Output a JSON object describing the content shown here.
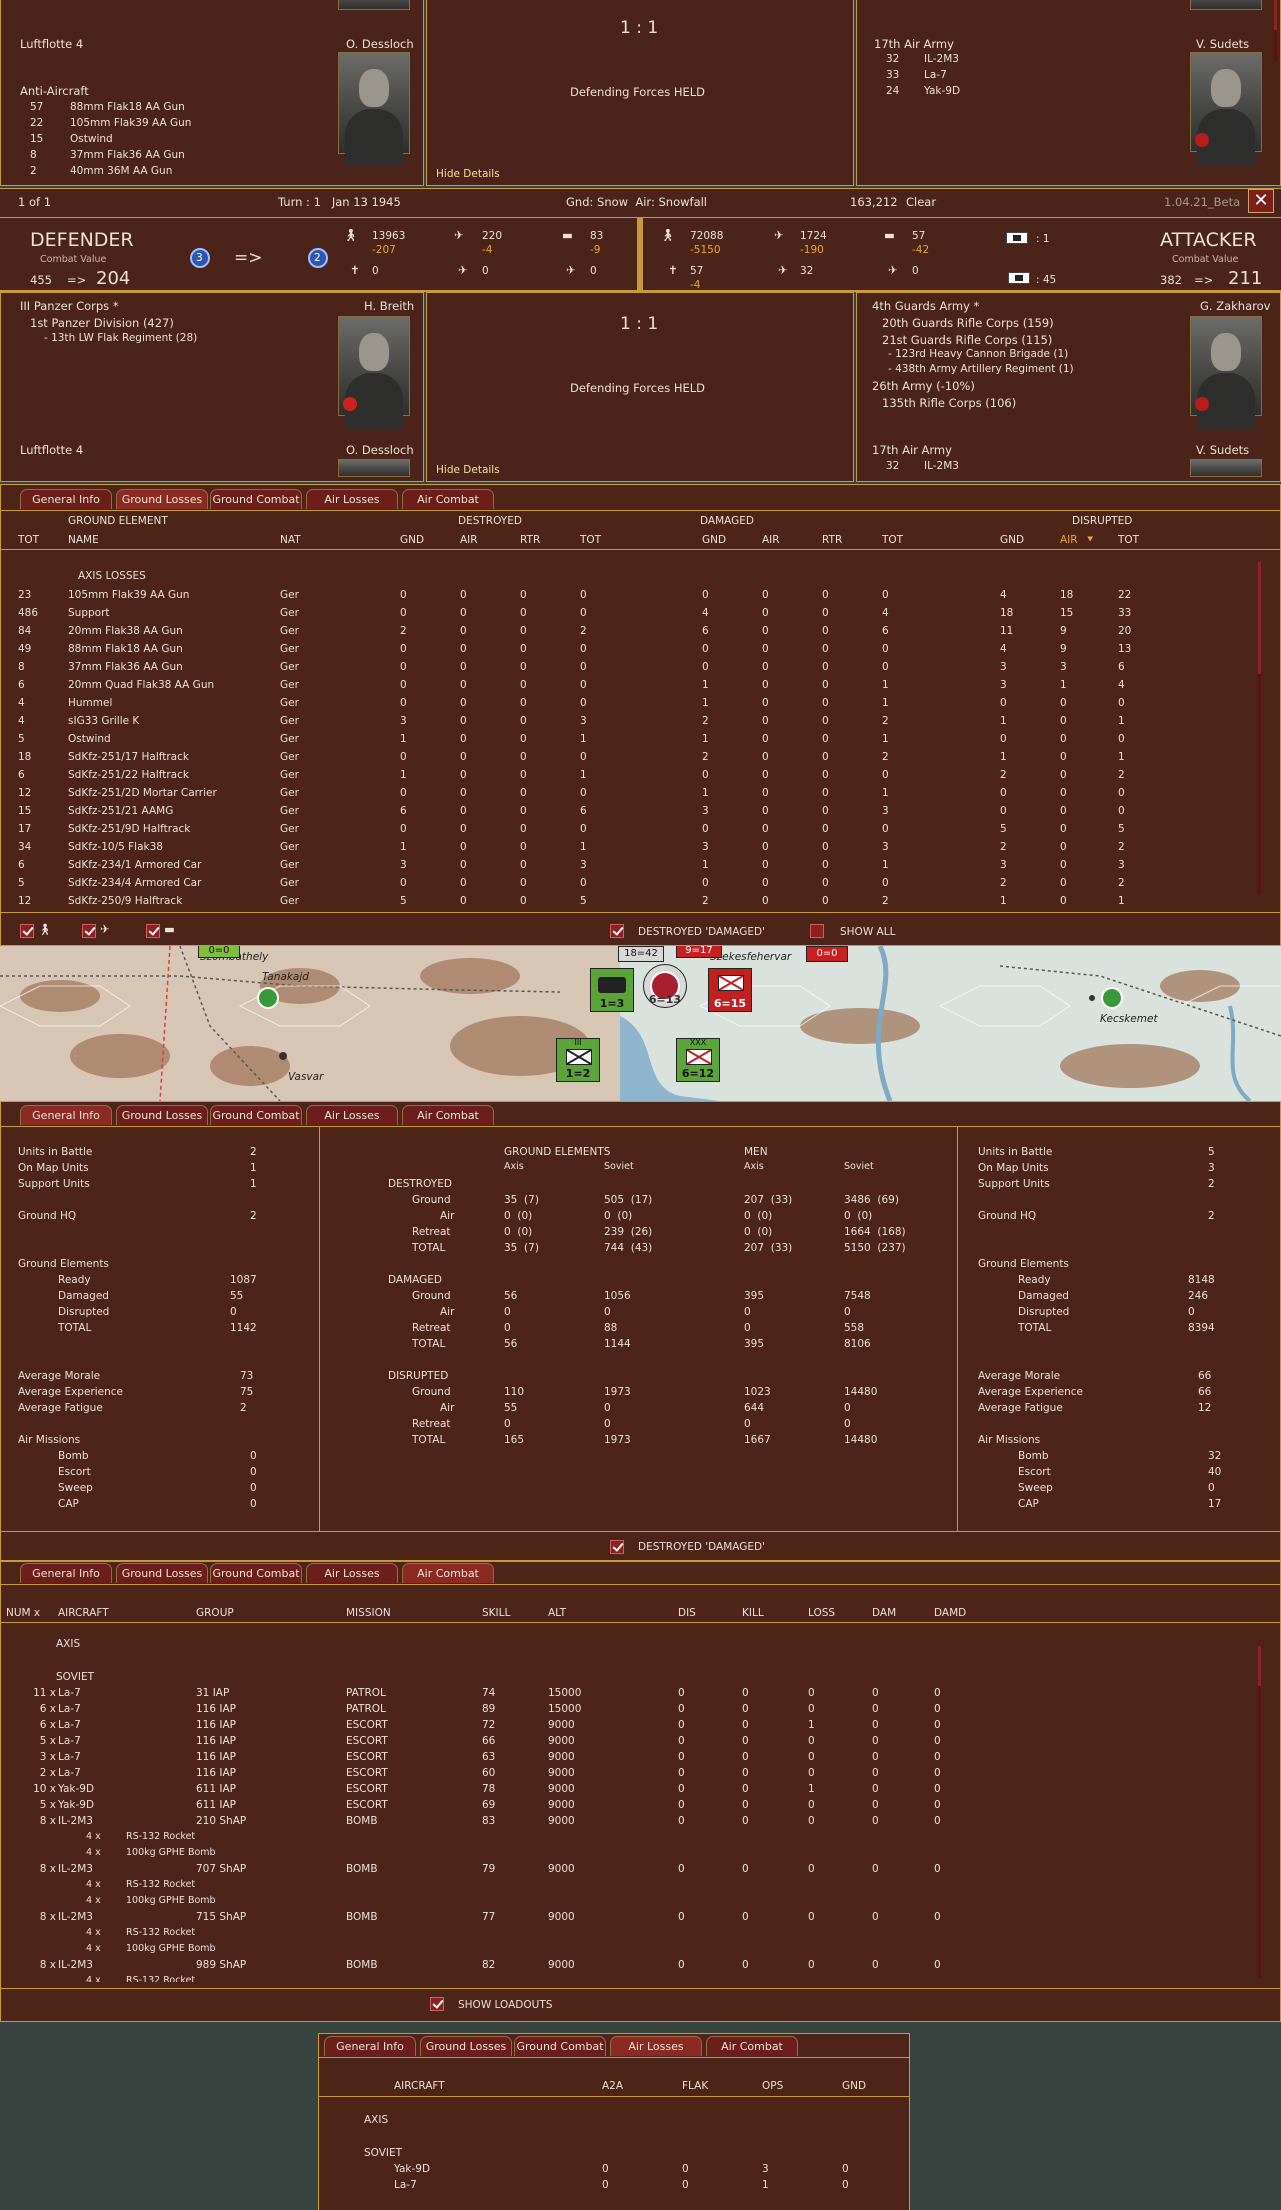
{
  "top_strip": {
    "left_cmd1": "Luftflotte 4",
    "left_leader1": "O. Dessloch",
    "aa_title": "Anti-Aircraft",
    "aa_rows": [
      {
        "n": "57",
        "name": "88mm Flak18 AA Gun"
      },
      {
        "n": "22",
        "name": "105mm Flak39 AA Gun"
      },
      {
        "n": "15",
        "name": "Ostwind"
      },
      {
        "n": "8",
        "name": "37mm Flak36 AA Gun"
      },
      {
        "n": "2",
        "name": "40mm 36M AA Gun"
      }
    ],
    "odds": "1 : 1",
    "result": "Defending Forces HELD",
    "hide_details": "Hide Details",
    "right_cmd": "17th Air Army",
    "right_leader": "V. Sudets",
    "air_rows": [
      {
        "n": "32",
        "name": "IL-2M3"
      },
      {
        "n": "33",
        "name": "La-7"
      },
      {
        "n": "24",
        "name": "Yak-9D"
      }
    ]
  },
  "info_bar": {
    "page": "1 of 1",
    "turn": "Turn : 1   Jan 13 1945",
    "ground": "Gnd: Snow  Air: Snowfall",
    "coords": "163,212",
    "weather": "Clear",
    "version": "1.04.21_Beta",
    "close": "✕"
  },
  "defender": {
    "title": "DEFENDER",
    "cv_label": "Combat Value",
    "cv_from": "455",
    "arrow": "=>",
    "cv_to": "204",
    "fort_from": "3",
    "fort_arrow": "=>",
    "fort_to": "2",
    "men": "13963",
    "men_loss": "-207",
    "guns": "220",
    "guns_loss": "-4",
    "afv": "83",
    "afv_loss": "-9",
    "c1": "0",
    "c2": "0",
    "c3": "0"
  },
  "attacker": {
    "title": "ATTACKER",
    "cv_label": "Combat Value",
    "cv_from": "382",
    "arrow": "=>",
    "cv_to": "211",
    "men": "72088",
    "men_loss": "-5150",
    "guns": "1724",
    "guns_loss": "-190",
    "afv": "57",
    "afv_loss": "-42",
    "c1": "57",
    "c1_loss": "-4",
    "c2": "32",
    "c3": "0",
    "flag1": ": 1",
    "flag2": ": 45"
  },
  "mid_strip": {
    "left_corps": "III Panzer Corps *",
    "left_leader": "H. Breith",
    "div": "1st Panzer Division (427)",
    "reg": "- 13th LW Flak Regiment (28)",
    "left_air": "Luftflotte 4",
    "left_air_leader": "O. Dessloch",
    "odds": "1 : 1",
    "result": "Defending Forces HELD",
    "hide_details": "Hide Details",
    "right_army": "4th Guards Army *",
    "right_leader": "G. Zakharov",
    "right_units": [
      "20th Guards Rifle Corps (159)",
      "21st Guards Rifle Corps (115)",
      "- 123rd Heavy Cannon Brigade (1)",
      "- 438th Army Artillery Regiment (1)",
      "26th Army (-10%)",
      "135th Rifle Corps (106)"
    ],
    "right_air": "17th Air Army",
    "right_air_leader": "V. Sudets",
    "right_air_row": {
      "n": "32",
      "name": "IL-2M3"
    }
  },
  "tabs": [
    "General Info",
    "Ground Losses",
    "Ground Combat",
    "Air Losses",
    "Air Combat"
  ],
  "ground_losses": {
    "group_headers": [
      "GROUND ELEMENT",
      "DESTROYED",
      "DAMAGED",
      "DISRUPTED"
    ],
    "columns": [
      "TOT",
      "NAME",
      "NAT",
      "GND",
      "AIR",
      "RTR",
      "TOT",
      "GND",
      "AIR",
      "RTR",
      "TOT",
      "GND",
      "AIR",
      "TOT"
    ],
    "section": "AXIS LOSSES",
    "rows": [
      [
        "23",
        "105mm Flak39 AA Gun",
        "Ger",
        "0",
        "0",
        "0",
        "0",
        "0",
        "0",
        "0",
        "0",
        "4",
        "18",
        "22"
      ],
      [
        "486",
        "Support",
        "Ger",
        "0",
        "0",
        "0",
        "0",
        "4",
        "0",
        "0",
        "4",
        "18",
        "15",
        "33"
      ],
      [
        "84",
        "20mm Flak38 AA Gun",
        "Ger",
        "2",
        "0",
        "0",
        "2",
        "6",
        "0",
        "0",
        "6",
        "11",
        "9",
        "20"
      ],
      [
        "49",
        "88mm Flak18 AA Gun",
        "Ger",
        "0",
        "0",
        "0",
        "0",
        "0",
        "0",
        "0",
        "0",
        "4",
        "9",
        "13"
      ],
      [
        "8",
        "37mm Flak36 AA Gun",
        "Ger",
        "0",
        "0",
        "0",
        "0",
        "0",
        "0",
        "0",
        "0",
        "3",
        "3",
        "6"
      ],
      [
        "6",
        "20mm Quad Flak38 AA Gun",
        "Ger",
        "0",
        "0",
        "0",
        "0",
        "1",
        "0",
        "0",
        "1",
        "3",
        "1",
        "4"
      ],
      [
        "4",
        "Hummel",
        "Ger",
        "0",
        "0",
        "0",
        "0",
        "1",
        "0",
        "0",
        "1",
        "0",
        "0",
        "0"
      ],
      [
        "4",
        "sIG33 Grille K",
        "Ger",
        "3",
        "0",
        "0",
        "3",
        "2",
        "0",
        "0",
        "2",
        "1",
        "0",
        "1"
      ],
      [
        "5",
        "Ostwind",
        "Ger",
        "1",
        "0",
        "0",
        "1",
        "1",
        "0",
        "0",
        "1",
        "0",
        "0",
        "0"
      ],
      [
        "18",
        "SdKfz-251/17 Halftrack",
        "Ger",
        "0",
        "0",
        "0",
        "0",
        "2",
        "0",
        "0",
        "2",
        "1",
        "0",
        "1"
      ],
      [
        "6",
        "SdKfz-251/22 Halftrack",
        "Ger",
        "1",
        "0",
        "0",
        "1",
        "0",
        "0",
        "0",
        "0",
        "2",
        "0",
        "2"
      ],
      [
        "12",
        "SdKfz-251/2D Mortar Carrier",
        "Ger",
        "0",
        "0",
        "0",
        "0",
        "1",
        "0",
        "0",
        "1",
        "0",
        "0",
        "0"
      ],
      [
        "15",
        "SdKfz-251/21 AAMG",
        "Ger",
        "6",
        "0",
        "0",
        "6",
        "3",
        "0",
        "0",
        "3",
        "0",
        "0",
        "0"
      ],
      [
        "17",
        "SdKfz-251/9D Halftrack",
        "Ger",
        "0",
        "0",
        "0",
        "0",
        "0",
        "0",
        "0",
        "0",
        "5",
        "0",
        "5"
      ],
      [
        "34",
        "SdKfz-10/5 Flak38",
        "Ger",
        "1",
        "0",
        "0",
        "1",
        "3",
        "0",
        "0",
        "3",
        "2",
        "0",
        "2"
      ],
      [
        "6",
        "SdKfz-234/1 Armored Car",
        "Ger",
        "3",
        "0",
        "0",
        "3",
        "1",
        "0",
        "0",
        "1",
        "3",
        "0",
        "3"
      ],
      [
        "5",
        "SdKfz-234/4 Armored Car",
        "Ger",
        "0",
        "0",
        "0",
        "0",
        "0",
        "0",
        "0",
        "0",
        "2",
        "0",
        "2"
      ],
      [
        "12",
        "SdKfz-250/9 Halftrack",
        "Ger",
        "5",
        "0",
        "0",
        "5",
        "2",
        "0",
        "0",
        "2",
        "1",
        "0",
        "1"
      ]
    ],
    "destroyed_damaged": "DESTROYED 'DAMAGED'",
    "show_all": "SHOW ALL"
  },
  "map": {
    "labels": [
      "Szombathely",
      "Tanakajd",
      "Vasvar",
      "Szekesfehervar",
      "Kecskemet"
    ],
    "units": [
      {
        "type": "panzer",
        "label": "1=3"
      },
      {
        "type": "tank",
        "label": "6=13"
      },
      {
        "type": "infantry",
        "label": "1=2"
      },
      {
        "type": "infantry",
        "label": "6=15"
      },
      {
        "type": "infantry",
        "label": "6=12"
      }
    ],
    "top_labels": [
      "0=0",
      "18=42",
      "9=17",
      "0=0"
    ],
    "unit_marks": [
      "III",
      "XXX"
    ]
  },
  "general_info": {
    "left": {
      "rows1": [
        [
          "Units in Battle",
          "2"
        ],
        [
          "On Map Units",
          "1"
        ],
        [
          "Support Units",
          "1"
        ]
      ],
      "hq": [
        "Ground HQ",
        "2"
      ],
      "ge_title": "Ground Elements",
      "ge_rows": [
        [
          "Ready",
          "1087"
        ],
        [
          "Damaged",
          "55"
        ],
        [
          "Disrupted",
          "0"
        ],
        [
          "TOTAL",
          "1142"
        ]
      ],
      "avg_rows": [
        [
          "Average Morale",
          "73"
        ],
        [
          "Average Experience",
          "75"
        ],
        [
          "Average Fatigue",
          "2"
        ]
      ],
      "air_title": "Air Missions",
      "air_rows": [
        [
          "Bomb",
          "0"
        ],
        [
          "Escort",
          "0"
        ],
        [
          "Sweep",
          "0"
        ],
        [
          "CAP",
          "0"
        ]
      ]
    },
    "right": {
      "rows1": [
        [
          "Units in Battle",
          "5"
        ],
        [
          "On Map Units",
          "3"
        ],
        [
          "Support Units",
          "2"
        ]
      ],
      "hq": [
        "Ground HQ",
        "2"
      ],
      "ge_title": "Ground Elements",
      "ge_rows": [
        [
          "Ready",
          "8148"
        ],
        [
          "Damaged",
          "246"
        ],
        [
          "Disrupted",
          "0"
        ],
        [
          "TOTAL",
          "8394"
        ]
      ],
      "avg_rows": [
        [
          "Average Morale",
          "66"
        ],
        [
          "Average Experience",
          "66"
        ],
        [
          "Average Fatigue",
          "12"
        ]
      ],
      "air_title": "Air Missions",
      "air_rows": [
        [
          "Bomb",
          "32"
        ],
        [
          "Escort",
          "40"
        ],
        [
          "Sweep",
          "0"
        ],
        [
          "CAP",
          "17"
        ]
      ]
    },
    "center": {
      "h_ge": "GROUND ELEMENTS",
      "h_men": "MEN",
      "sub": [
        "Axis",
        "Soviet",
        "Axis",
        "Soviet"
      ],
      "sections": [
        {
          "title": "DESTROYED",
          "rows": [
            [
              "Ground",
              "35  (7)",
              "505  (17)",
              "207  (33)",
              "3486  (69)"
            ],
            [
              "Air",
              "0  (0)",
              "0  (0)",
              "0  (0)",
              "0  (0)"
            ],
            [
              "Retreat",
              "0  (0)",
              "239  (26)",
              "0  (0)",
              "1664  (168)"
            ],
            [
              "TOTAL",
              "35  (7)",
              "744  (43)",
              "207  (33)",
              "5150  (237)"
            ]
          ]
        },
        {
          "title": "DAMAGED",
          "rows": [
            [
              "Ground",
              "56",
              "1056",
              "395",
              "7548"
            ],
            [
              "Air",
              "0",
              "0",
              "0",
              "0"
            ],
            [
              "Retreat",
              "0",
              "88",
              "0",
              "558"
            ],
            [
              "TOTAL",
              "56",
              "1144",
              "395",
              "8106"
            ]
          ]
        },
        {
          "title": "DISRUPTED",
          "rows": [
            [
              "Ground",
              "110",
              "1973",
              "1023",
              "14480"
            ],
            [
              "Air",
              "55",
              "0",
              "644",
              "0"
            ],
            [
              "Retreat",
              "0",
              "0",
              "0",
              "0"
            ],
            [
              "TOTAL",
              "165",
              "1973",
              "1667",
              "14480"
            ]
          ]
        }
      ]
    },
    "destroyed_damaged": "DESTROYED 'DAMAGED'"
  },
  "air_combat": {
    "columns": [
      "NUM x",
      "AIRCRAFT",
      "GROUP",
      "MISSION",
      "SKILL",
      "ALT",
      "DIS",
      "KILL",
      "LOSS",
      "DAM",
      "DAMD"
    ],
    "axis": "AXIS",
    "soviet": "SOVIET",
    "rows": [
      {
        "num": "11 x",
        "ac": "La-7",
        "grp": "31 IAP",
        "mis": "PATROL",
        "skill": "74",
        "alt": "15000",
        "v": [
          "0",
          "0",
          "0",
          "0",
          "0"
        ],
        "load": []
      },
      {
        "num": "6 x",
        "ac": "La-7",
        "grp": "116 IAP",
        "mis": "PATROL",
        "skill": "89",
        "alt": "15000",
        "v": [
          "0",
          "0",
          "0",
          "0",
          "0"
        ],
        "load": []
      },
      {
        "num": "6 x",
        "ac": "La-7",
        "grp": "116 IAP",
        "mis": "ESCORT",
        "skill": "72",
        "alt": "9000",
        "v": [
          "0",
          "0",
          "1",
          "0",
          "0"
        ],
        "load": []
      },
      {
        "num": "5 x",
        "ac": "La-7",
        "grp": "116 IAP",
        "mis": "ESCORT",
        "skill": "66",
        "alt": "9000",
        "v": [
          "0",
          "0",
          "0",
          "0",
          "0"
        ],
        "load": []
      },
      {
        "num": "3 x",
        "ac": "La-7",
        "grp": "116 IAP",
        "mis": "ESCORT",
        "skill": "63",
        "alt": "9000",
        "v": [
          "0",
          "0",
          "0",
          "0",
          "0"
        ],
        "load": []
      },
      {
        "num": "2 x",
        "ac": "La-7",
        "grp": "116 IAP",
        "mis": "ESCORT",
        "skill": "60",
        "alt": "9000",
        "v": [
          "0",
          "0",
          "0",
          "0",
          "0"
        ],
        "load": []
      },
      {
        "num": "10 x",
        "ac": "Yak-9D",
        "grp": "611 IAP",
        "mis": "ESCORT",
        "skill": "78",
        "alt": "9000",
        "v": [
          "0",
          "0",
          "1",
          "0",
          "0"
        ],
        "load": []
      },
      {
        "num": "5 x",
        "ac": "Yak-9D",
        "grp": "611 IAP",
        "mis": "ESCORT",
        "skill": "69",
        "alt": "9000",
        "v": [
          "0",
          "0",
          "0",
          "0",
          "0"
        ],
        "load": []
      },
      {
        "num": "8 x",
        "ac": "IL-2M3",
        "grp": "210 ShAP",
        "mis": "BOMB",
        "skill": "83",
        "alt": "9000",
        "v": [
          "0",
          "0",
          "0",
          "0",
          "0"
        ],
        "load": [
          [
            "4 x",
            "RS-132 Rocket"
          ],
          [
            "4 x",
            "100kg GPHE Bomb"
          ]
        ]
      },
      {
        "num": "8 x",
        "ac": "IL-2M3",
        "grp": "707 ShAP",
        "mis": "BOMB",
        "skill": "79",
        "alt": "9000",
        "v": [
          "0",
          "0",
          "0",
          "0",
          "0"
        ],
        "load": [
          [
            "4 x",
            "RS-132 Rocket"
          ],
          [
            "4 x",
            "100kg GPHE Bomb"
          ]
        ]
      },
      {
        "num": "8 x",
        "ac": "IL-2M3",
        "grp": "715 ShAP",
        "mis": "BOMB",
        "skill": "77",
        "alt": "9000",
        "v": [
          "0",
          "0",
          "0",
          "0",
          "0"
        ],
        "load": [
          [
            "4 x",
            "RS-132 Rocket"
          ],
          [
            "4 x",
            "100kg GPHE Bomb"
          ]
        ]
      },
      {
        "num": "8 x",
        "ac": "IL-2M3",
        "grp": "989 ShAP",
        "mis": "BOMB",
        "skill": "82",
        "alt": "9000",
        "v": [
          "0",
          "0",
          "0",
          "0",
          "0"
        ],
        "load": [
          [
            "4 x",
            "RS-132 Rocket"
          ]
        ]
      }
    ],
    "show_loadouts": "SHOW LOADOUTS"
  },
  "air_losses": {
    "columns": [
      "AIRCRAFT",
      "A2A",
      "FLAK",
      "OPS",
      "GND"
    ],
    "axis": "AXIS",
    "soviet": "SOVIET",
    "rows": [
      [
        "Yak-9D",
        "0",
        "0",
        "3",
        "0"
      ],
      [
        "La-7",
        "0",
        "0",
        "1",
        "0"
      ]
    ]
  }
}
